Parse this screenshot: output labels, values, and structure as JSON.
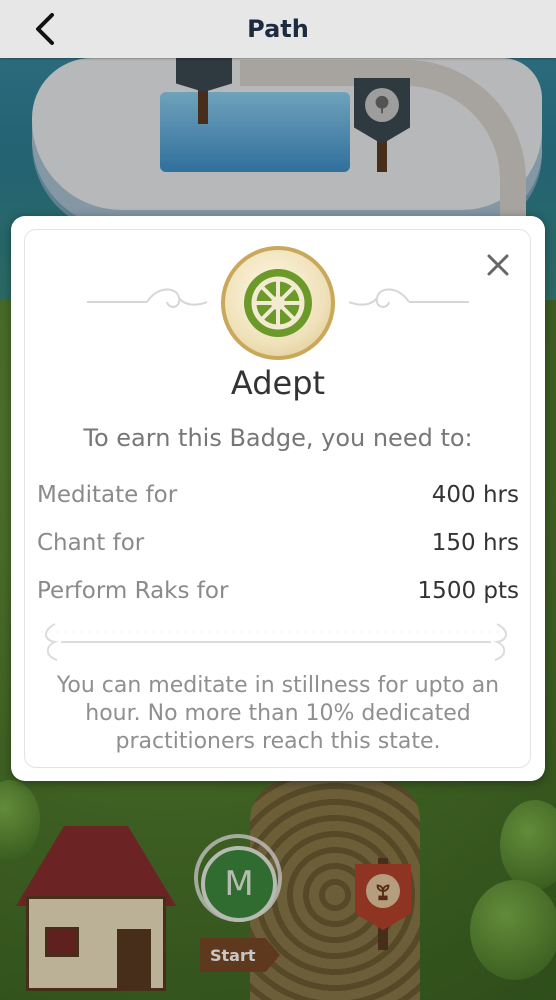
{
  "header": {
    "title": "Path"
  },
  "badge_modal": {
    "badge_name": "Adept",
    "subtitle": "To earn this Badge, you need to:",
    "requirements": [
      {
        "label": "Meditate for",
        "value": "400 hrs"
      },
      {
        "label": "Chant for",
        "value": "150 hrs"
      },
      {
        "label": "Perform Raks for",
        "value": "1500 pts"
      }
    ],
    "description": "You can meditate in stillness for upto an hour. No more than 10% dedicated practitioners reach this state."
  },
  "map": {
    "start_medallion_letter": "M",
    "start_sign_label": "Start"
  },
  "icons": {
    "back": "chevron-left-icon",
    "close": "close-icon",
    "badge": "dharma-wheel-icon",
    "tree_banner": "tree-icon",
    "plant_banner": "sprout-icon"
  },
  "colors": {
    "header_bg": "#e7e7e7",
    "title_text": "#1d2b40",
    "badge_green": "#6b9a2a",
    "medal_gold": "#c9a85a",
    "start_green": "#3e8a3e"
  }
}
